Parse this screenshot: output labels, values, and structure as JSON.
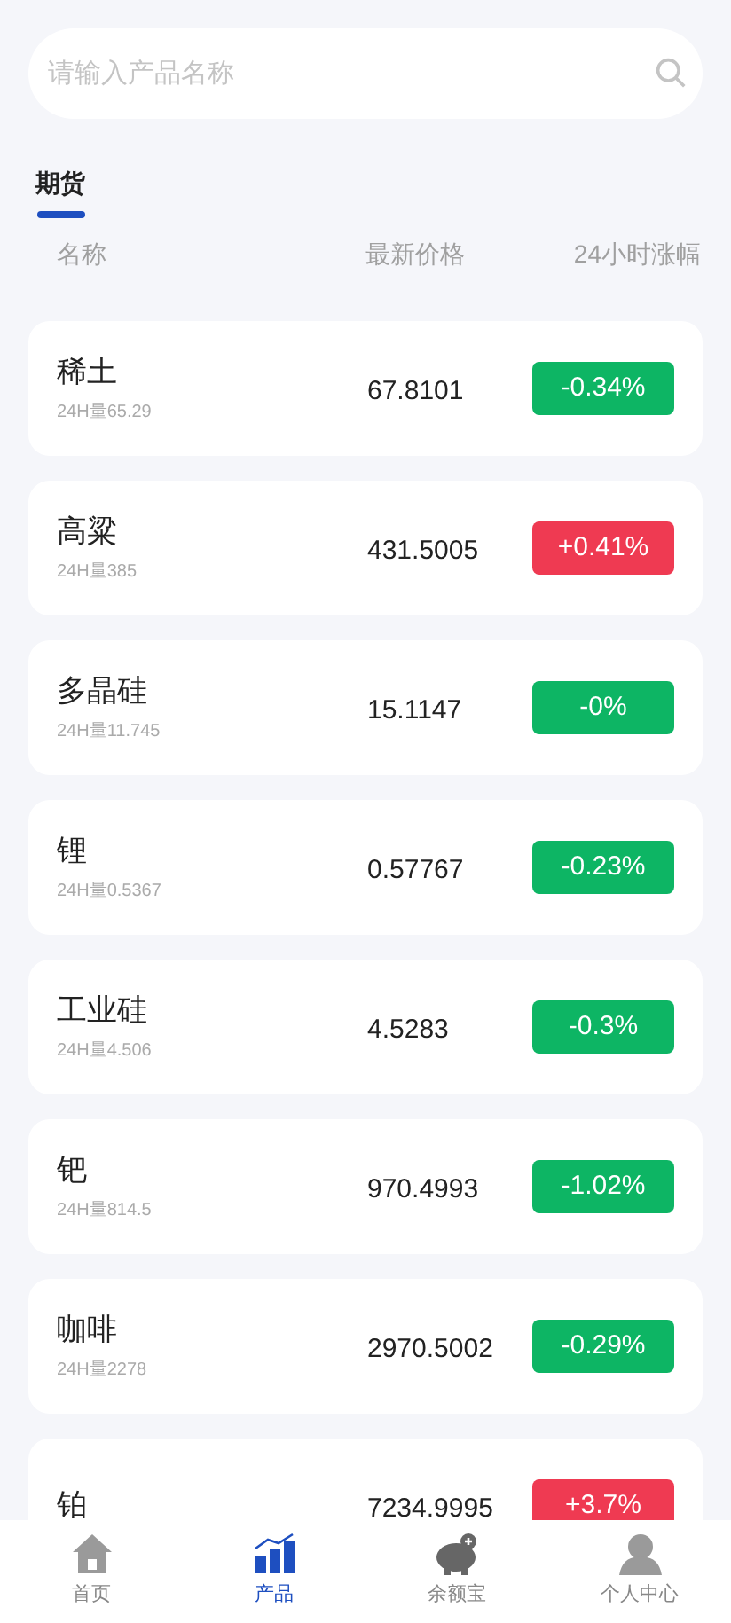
{
  "search": {
    "placeholder": "请输入产品名称"
  },
  "tabs": [
    {
      "label": "期货",
      "selected": true
    }
  ],
  "columns": [
    "名称",
    "最新价格",
    "24小时涨幅"
  ],
  "rows": [
    {
      "name": "稀土",
      "volume": "24H量65.29",
      "price": "67.8101",
      "change": "-0.34%",
      "kind": "fall"
    },
    {
      "name": "高粱",
      "volume": "24H量385",
      "price": "431.5005",
      "change": "+0.41%",
      "kind": "rise"
    },
    {
      "name": "多晶硅",
      "volume": "24H量11.745",
      "price": "15.1147",
      "change": "-0%",
      "kind": "fall"
    },
    {
      "name": "锂",
      "volume": "24H量0.5367",
      "price": "0.57767",
      "change": "-0.23%",
      "kind": "fall"
    },
    {
      "name": "工业硅",
      "volume": "24H量4.506",
      "price": "4.5283",
      "change": "-0.3%",
      "kind": "fall"
    },
    {
      "name": "钯",
      "volume": "24H量814.5",
      "price": "970.4993",
      "change": "-1.02%",
      "kind": "fall"
    },
    {
      "name": "咖啡",
      "volume": "24H量2278",
      "price": "2970.5002",
      "change": "-0.29%",
      "kind": "fall"
    },
    {
      "name": "铂",
      "price": "7234.9995",
      "change": "+3.7%",
      "kind": "rise"
    }
  ],
  "nav": [
    {
      "label": "首页",
      "kind": "home",
      "selected": false
    },
    {
      "label": "产品",
      "kind": "chart",
      "selected": true
    },
    {
      "label": "余额宝",
      "kind": "piggy",
      "selected": false
    },
    {
      "label": "个人中心",
      "kind": "user",
      "selected": false
    }
  ]
}
